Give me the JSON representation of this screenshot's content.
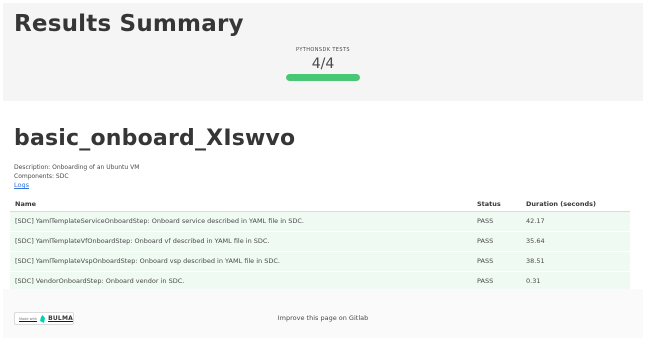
{
  "summary": {
    "title": "Results Summary",
    "kpi_label": "PYTHONSDK TESTS",
    "kpi_value": "4/4",
    "kpi_progress": 1.0,
    "kpi_color": "#48c774"
  },
  "suite": {
    "title": "basic_onboard_XIswvo",
    "description": "Description: Onboarding of an Ubuntu VM",
    "components": "Components: SDC",
    "logs_label": "Logs"
  },
  "table": {
    "headers": [
      "Name",
      "Status",
      "Duration (seconds)"
    ],
    "rows": [
      {
        "name": "[SDC] YamlTemplateServiceOnboardStep: Onboard service described in YAML file in SDC.",
        "status": "PASS",
        "duration": "42.17"
      },
      {
        "name": "[SDC] YamlTemplateVfOnboardStep: Onboard vf described in YAML file in SDC.",
        "status": "PASS",
        "duration": "35.64"
      },
      {
        "name": "[SDC] YamlTemplateVspOnboardStep: Onboard vsp described in YAML file in SDC.",
        "status": "PASS",
        "duration": "38.51"
      },
      {
        "name": "[SDC] VendorOnboardStep: Onboard vendor in SDC.",
        "status": "PASS",
        "duration": "0.31"
      }
    ]
  },
  "footer": {
    "badge_made_with": "Made with",
    "badge_brand": "BULMA",
    "link_text": "Improve this page on Gitlab"
  }
}
